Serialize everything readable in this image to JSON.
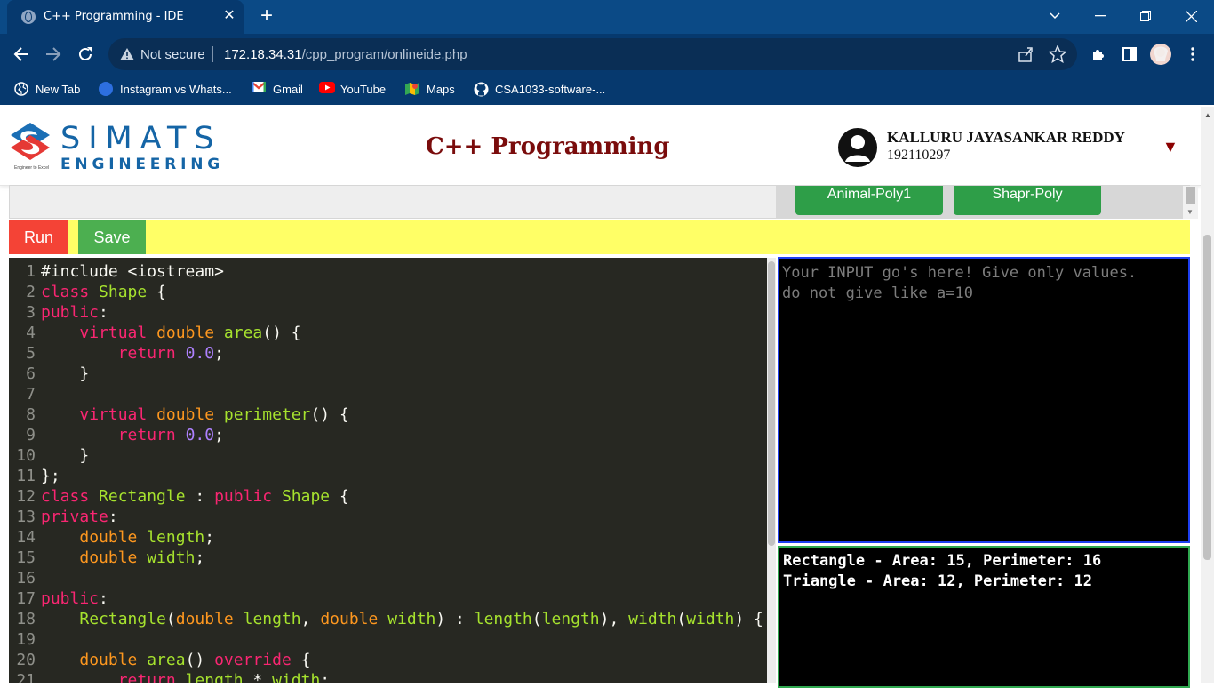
{
  "browser": {
    "tab_title": "C++ Programming - IDE",
    "not_secure_label": "Not secure",
    "url_host": "172.18.34.31",
    "url_path": "/cpp_program/onlineide.php",
    "bookmarks": [
      "New Tab",
      "Instagram vs Whats...",
      "Gmail",
      "YouTube",
      "Maps",
      "CSA1033-software-..."
    ]
  },
  "header": {
    "logo_line1": "SIMATS",
    "logo_line2": "ENGINEERING",
    "logo_tagline": "Engineer to Excel",
    "title": "C++ Programming",
    "user_name": "KALLURU JAYASANKAR REDDY",
    "user_id": "192110297"
  },
  "programs": [
    "Animal-Poly1",
    "Shapr-Poly"
  ],
  "toolbar": {
    "run_label": "Run",
    "save_label": "Save"
  },
  "editor": {
    "lines": [
      [
        [
          "plain",
          "#include <iostream>"
        ]
      ],
      [
        [
          "kw",
          "class "
        ],
        [
          "fn",
          "Shape"
        ],
        [
          "plain",
          " {"
        ]
      ],
      [
        [
          "kw",
          "public"
        ],
        [
          "plain",
          ":"
        ]
      ],
      [
        [
          "plain",
          "    "
        ],
        [
          "kw",
          "virtual "
        ],
        [
          "type",
          "double "
        ],
        [
          "fn",
          "area"
        ],
        [
          "plain",
          "() {"
        ]
      ],
      [
        [
          "plain",
          "        "
        ],
        [
          "kw",
          "return "
        ],
        [
          "num",
          "0.0"
        ],
        [
          "plain",
          ";"
        ]
      ],
      [
        [
          "plain",
          "    }"
        ]
      ],
      [
        [
          "plain",
          ""
        ]
      ],
      [
        [
          "plain",
          "    "
        ],
        [
          "kw",
          "virtual "
        ],
        [
          "type",
          "double "
        ],
        [
          "fn",
          "perimeter"
        ],
        [
          "plain",
          "() {"
        ]
      ],
      [
        [
          "plain",
          "        "
        ],
        [
          "kw",
          "return "
        ],
        [
          "num",
          "0.0"
        ],
        [
          "plain",
          ";"
        ]
      ],
      [
        [
          "plain",
          "    }"
        ]
      ],
      [
        [
          "plain",
          "};"
        ]
      ],
      [
        [
          "kw",
          "class "
        ],
        [
          "fn",
          "Rectangle"
        ],
        [
          "plain",
          " : "
        ],
        [
          "kw",
          "public "
        ],
        [
          "fn",
          "Shape"
        ],
        [
          "plain",
          " {"
        ]
      ],
      [
        [
          "kw",
          "private"
        ],
        [
          "plain",
          ":"
        ]
      ],
      [
        [
          "plain",
          "    "
        ],
        [
          "type",
          "double "
        ],
        [
          "fn",
          "length"
        ],
        [
          "plain",
          ";"
        ]
      ],
      [
        [
          "plain",
          "    "
        ],
        [
          "type",
          "double "
        ],
        [
          "fn",
          "width"
        ],
        [
          "plain",
          ";"
        ]
      ],
      [
        [
          "plain",
          ""
        ]
      ],
      [
        [
          "kw",
          "public"
        ],
        [
          "plain",
          ":"
        ]
      ],
      [
        [
          "plain",
          "    "
        ],
        [
          "fn",
          "Rectangle"
        ],
        [
          "plain",
          "("
        ],
        [
          "type",
          "double "
        ],
        [
          "fn",
          "length"
        ],
        [
          "plain",
          ", "
        ],
        [
          "type",
          "double "
        ],
        [
          "fn",
          "width"
        ],
        [
          "plain",
          ") : "
        ],
        [
          "fn",
          "length"
        ],
        [
          "plain",
          "("
        ],
        [
          "fn",
          "length"
        ],
        [
          "plain",
          "), "
        ],
        [
          "fn",
          "width"
        ],
        [
          "plain",
          "("
        ],
        [
          "fn",
          "width"
        ],
        [
          "plain",
          ") {"
        ]
      ],
      [
        [
          "plain",
          ""
        ]
      ],
      [
        [
          "plain",
          "    "
        ],
        [
          "type",
          "double "
        ],
        [
          "fn",
          "area"
        ],
        [
          "plain",
          "() "
        ],
        [
          "kw",
          "override"
        ],
        [
          "plain",
          " {"
        ]
      ],
      [
        [
          "plain",
          "        "
        ],
        [
          "kw",
          "return "
        ],
        [
          "fn",
          "length"
        ],
        [
          "plain",
          " * "
        ],
        [
          "fn",
          "width"
        ],
        [
          "plain",
          ";"
        ]
      ]
    ]
  },
  "input": {
    "placeholder_line1": "Your INPUT go's here! Give only values.",
    "placeholder_line2": "do not give like a=10"
  },
  "output": {
    "line1": "Rectangle - Area: 15, Perimeter: 16",
    "line2": "Triangle - Area: 12, Perimeter: 12"
  }
}
